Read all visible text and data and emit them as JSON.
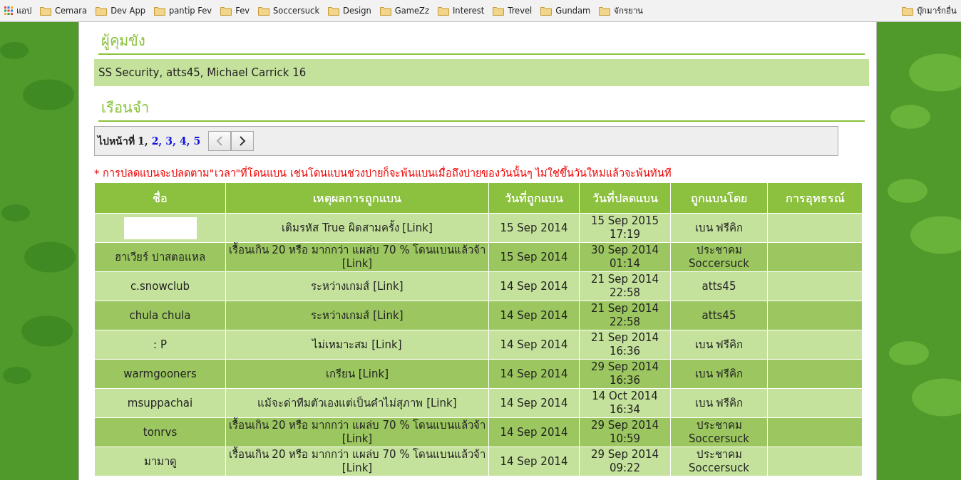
{
  "bookmarks_bar": {
    "apps_label": "แอป",
    "folders": [
      "Cemara",
      "Dev App",
      "pantip Fev",
      "Fev",
      "Soccersuck",
      "Design",
      "GameZz",
      "Interest",
      "Trevel",
      "Gundam",
      "จักรยาน"
    ],
    "other_bookmarks": "บุ๊กมาร์กอื่น"
  },
  "wardens": {
    "heading": "ผู้คุมขัง",
    "text": "SS Security, atts45, Michael Carrick 16"
  },
  "prison": {
    "heading": "เรือนจำ",
    "pagination": {
      "label": "ไปหน้าที่",
      "pages": [
        {
          "label": "1,",
          "selected": true
        },
        {
          "label": "2,",
          "selected": false
        },
        {
          "label": "3,",
          "selected": false
        },
        {
          "label": "4,",
          "selected": false
        },
        {
          "label": "5",
          "selected": false
        }
      ],
      "prev_disabled": true,
      "next_disabled": false
    },
    "note": "* การปลดแบนจะปลดตาม\"เวลา\"ที่โดนแบน เช่นโดนแบนช่วงบ่ายก็จะพ้นแบนเมื่อถึงบ่ายของวันนั้นๆ ไม่ใช่ขึ้นวันใหม่แล้วจะพ้นทันที",
    "table": {
      "columns": [
        "ชื่อ",
        "เหตุผลการถูกแบน",
        "วันที่ถูกแบน",
        "วันที่ปลดแบน",
        "ถูกแบนโดย",
        "การอุทธรณ์"
      ],
      "rows": [
        {
          "name_hidden": true,
          "reason": "เติมรหัส True ผิดสามครั้ง [Link]",
          "banned": "15 Sep 2014",
          "released": "15 Sep 2015 17:19",
          "by": "เบน ฟรีคิก"
        },
        {
          "name": "ฮาเวียร์ ปาสตอแหล",
          "reason": "เรื้อนเกิน 20 หรือ มากกว่า แผล่บ 70 % โดนแบนแล้วจ้า [Link]",
          "banned": "15 Sep 2014",
          "released": "30 Sep 2014 01:14",
          "by": "ประชาคม Soccersuck"
        },
        {
          "name": "c.snowclub",
          "reason": "ระหว่างเกมส์ [Link]",
          "banned": "14 Sep 2014",
          "released": "21 Sep 2014 22:58",
          "by": "atts45"
        },
        {
          "name": "chula chula",
          "reason": "ระหว่างเกมส์ [Link]",
          "banned": "14 Sep 2014",
          "released": "21 Sep 2014 22:58",
          "by": "atts45"
        },
        {
          "name": ": P",
          "reason": "ไม่เหมาะสม [Link]",
          "banned": "14 Sep 2014",
          "released": "21 Sep 2014 16:36",
          "by": "เบน ฟรีคิก"
        },
        {
          "name": "warmgooners",
          "reason": "เกรียน [Link]",
          "banned": "14 Sep 2014",
          "released": "29 Sep 2014 16:36",
          "by": "เบน ฟรีคิก"
        },
        {
          "name": "msuppachai",
          "reason": "แม้จะด่าทีมตัวเองแต่เป็นคำไม่สุภาพ [Link]",
          "banned": "14 Sep 2014",
          "released": "14 Oct 2014 16:34",
          "by": "เบน ฟรีคิก"
        },
        {
          "name": "tonrvs",
          "reason": "เรื้อนเกิน 20 หรือ มากกว่า แผล่บ 70 % โดนแบนแล้วจ้า [Link]",
          "banned": "14 Sep 2014",
          "released": "29 Sep 2014 10:59",
          "by": "ประชาคม Soccersuck"
        },
        {
          "name": "มามาดู",
          "reason": "เรื้อนเกิน 20 หรือ มากกว่า แผล่บ 70 % โดนแบนแล้วจ้า [Link]",
          "banned": "14 Sep 2014",
          "released": "29 Sep 2014 09:22",
          "by": "ประชาคม Soccersuck"
        }
      ]
    }
  }
}
